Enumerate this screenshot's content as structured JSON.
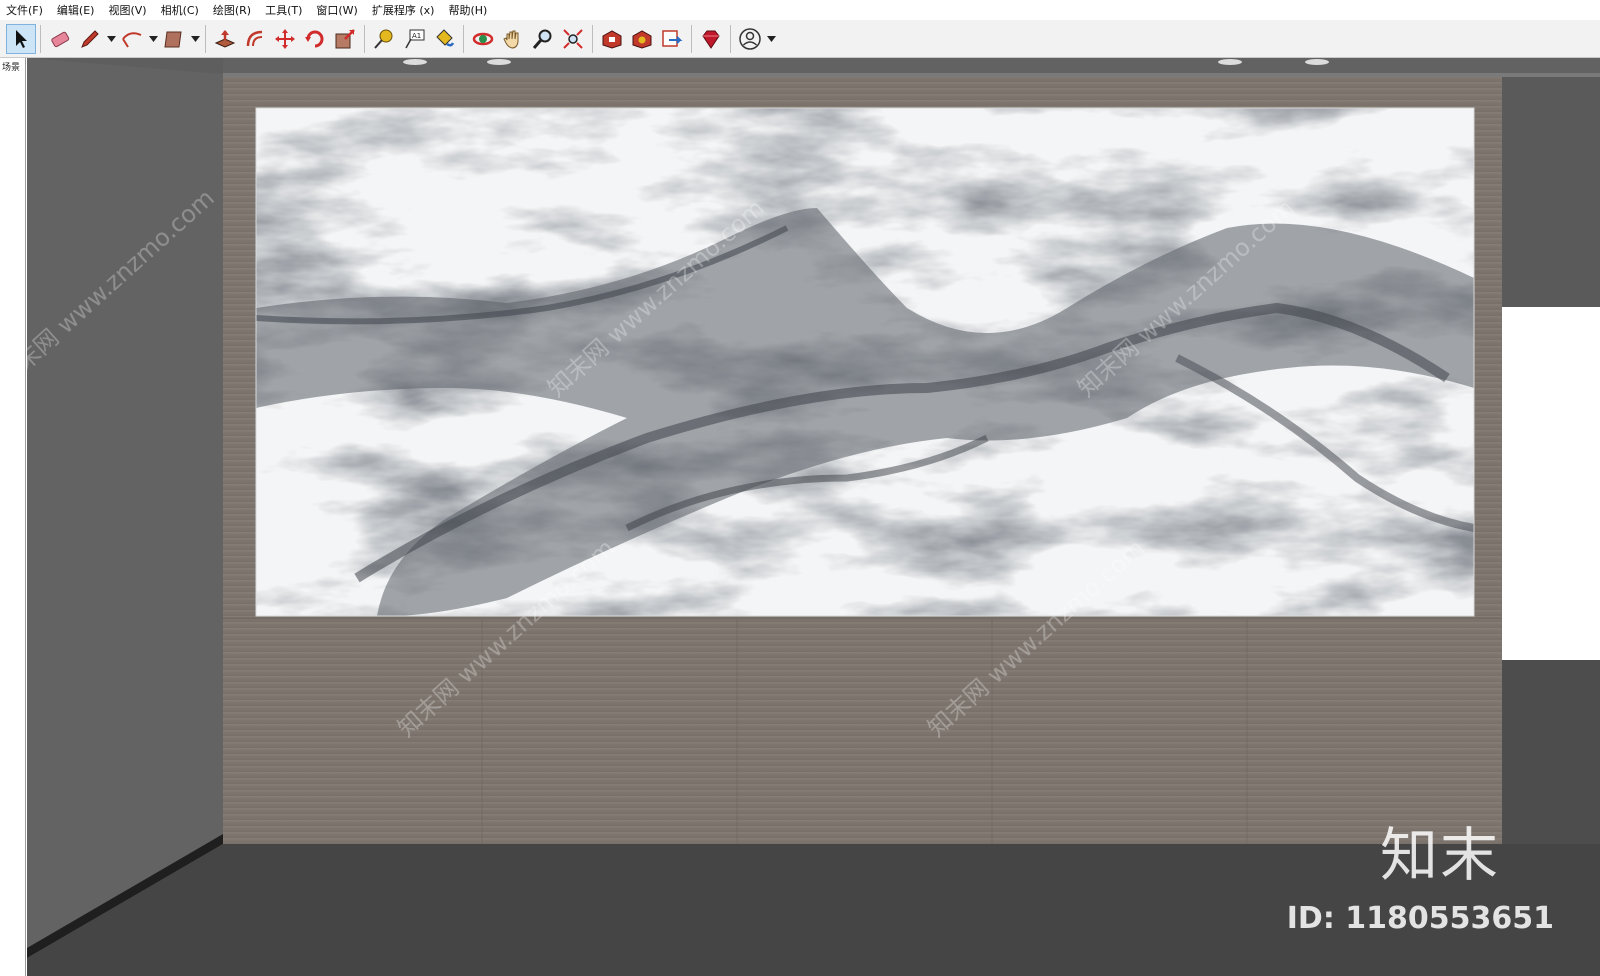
{
  "menu": [
    {
      "label": "文件(F)"
    },
    {
      "label": "编辑(E)"
    },
    {
      "label": "视图(V)"
    },
    {
      "label": "相机(C)"
    },
    {
      "label": "绘图(R)"
    },
    {
      "label": "工具(T)"
    },
    {
      "label": "窗口(W)"
    },
    {
      "label": "扩展程序 (x)"
    },
    {
      "label": "帮助(H)"
    }
  ],
  "toolbar": {
    "tools": [
      {
        "icon": "select-arrow-icon",
        "selected": true
      },
      {
        "icon": "eraser-icon"
      },
      {
        "icon": "pencil-line-icon",
        "dropdown": true
      },
      {
        "icon": "arc-icon",
        "dropdown": true
      },
      {
        "icon": "rectangle-shape-icon",
        "dropdown": true
      },
      {
        "icon": "push-pull-icon"
      },
      {
        "icon": "offset-icon"
      },
      {
        "icon": "move-icon"
      },
      {
        "icon": "rotate-icon"
      },
      {
        "icon": "scale-icon"
      },
      {
        "icon": "tape-measure-icon"
      },
      {
        "icon": "text-label-icon"
      },
      {
        "icon": "paint-bucket-icon"
      },
      {
        "icon": "orbit-icon"
      },
      {
        "icon": "pan-hand-icon"
      },
      {
        "icon": "zoom-icon"
      },
      {
        "icon": "zoom-extents-icon"
      },
      {
        "icon": "warehouse-icon"
      },
      {
        "icon": "extension-warehouse-icon"
      },
      {
        "icon": "layout-send-icon"
      },
      {
        "icon": "ruby-console-icon"
      },
      {
        "icon": "account-user-icon",
        "dropdown": true
      }
    ],
    "colors": {
      "selected_bg": "#cde4f7",
      "background": "#f2f2f2"
    }
  },
  "scene": {
    "tab_label": "场景"
  },
  "viewport": {
    "background": "#5e5e5e",
    "wall_color": "#7d766f",
    "floor_color": "#454545",
    "marble_description": "marble-slab-panel"
  },
  "watermark": {
    "logo_text": "知末",
    "id_text": "ID: 1180553651",
    "diagonal_text": "知末网 www.znzmo.com"
  }
}
